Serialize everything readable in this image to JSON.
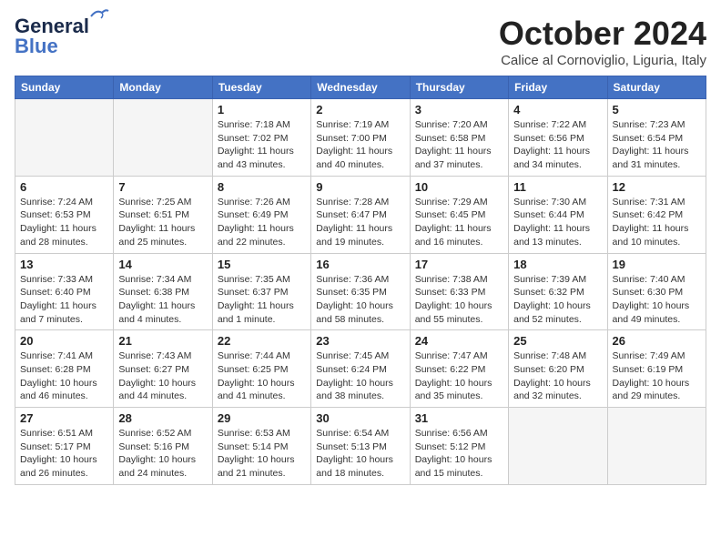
{
  "header": {
    "logo_line1": "General",
    "logo_line2": "Blue",
    "month": "October 2024",
    "location": "Calice al Cornoviglio, Liguria, Italy"
  },
  "weekdays": [
    "Sunday",
    "Monday",
    "Tuesday",
    "Wednesday",
    "Thursday",
    "Friday",
    "Saturday"
  ],
  "weeks": [
    [
      {
        "day": "",
        "info": ""
      },
      {
        "day": "",
        "info": ""
      },
      {
        "day": "1",
        "info": "Sunrise: 7:18 AM\nSunset: 7:02 PM\nDaylight: 11 hours and 43 minutes."
      },
      {
        "day": "2",
        "info": "Sunrise: 7:19 AM\nSunset: 7:00 PM\nDaylight: 11 hours and 40 minutes."
      },
      {
        "day": "3",
        "info": "Sunrise: 7:20 AM\nSunset: 6:58 PM\nDaylight: 11 hours and 37 minutes."
      },
      {
        "day": "4",
        "info": "Sunrise: 7:22 AM\nSunset: 6:56 PM\nDaylight: 11 hours and 34 minutes."
      },
      {
        "day": "5",
        "info": "Sunrise: 7:23 AM\nSunset: 6:54 PM\nDaylight: 11 hours and 31 minutes."
      }
    ],
    [
      {
        "day": "6",
        "info": "Sunrise: 7:24 AM\nSunset: 6:53 PM\nDaylight: 11 hours and 28 minutes."
      },
      {
        "day": "7",
        "info": "Sunrise: 7:25 AM\nSunset: 6:51 PM\nDaylight: 11 hours and 25 minutes."
      },
      {
        "day": "8",
        "info": "Sunrise: 7:26 AM\nSunset: 6:49 PM\nDaylight: 11 hours and 22 minutes."
      },
      {
        "day": "9",
        "info": "Sunrise: 7:28 AM\nSunset: 6:47 PM\nDaylight: 11 hours and 19 minutes."
      },
      {
        "day": "10",
        "info": "Sunrise: 7:29 AM\nSunset: 6:45 PM\nDaylight: 11 hours and 16 minutes."
      },
      {
        "day": "11",
        "info": "Sunrise: 7:30 AM\nSunset: 6:44 PM\nDaylight: 11 hours and 13 minutes."
      },
      {
        "day": "12",
        "info": "Sunrise: 7:31 AM\nSunset: 6:42 PM\nDaylight: 11 hours and 10 minutes."
      }
    ],
    [
      {
        "day": "13",
        "info": "Sunrise: 7:33 AM\nSunset: 6:40 PM\nDaylight: 11 hours and 7 minutes."
      },
      {
        "day": "14",
        "info": "Sunrise: 7:34 AM\nSunset: 6:38 PM\nDaylight: 11 hours and 4 minutes."
      },
      {
        "day": "15",
        "info": "Sunrise: 7:35 AM\nSunset: 6:37 PM\nDaylight: 11 hours and 1 minute."
      },
      {
        "day": "16",
        "info": "Sunrise: 7:36 AM\nSunset: 6:35 PM\nDaylight: 10 hours and 58 minutes."
      },
      {
        "day": "17",
        "info": "Sunrise: 7:38 AM\nSunset: 6:33 PM\nDaylight: 10 hours and 55 minutes."
      },
      {
        "day": "18",
        "info": "Sunrise: 7:39 AM\nSunset: 6:32 PM\nDaylight: 10 hours and 52 minutes."
      },
      {
        "day": "19",
        "info": "Sunrise: 7:40 AM\nSunset: 6:30 PM\nDaylight: 10 hours and 49 minutes."
      }
    ],
    [
      {
        "day": "20",
        "info": "Sunrise: 7:41 AM\nSunset: 6:28 PM\nDaylight: 10 hours and 46 minutes."
      },
      {
        "day": "21",
        "info": "Sunrise: 7:43 AM\nSunset: 6:27 PM\nDaylight: 10 hours and 44 minutes."
      },
      {
        "day": "22",
        "info": "Sunrise: 7:44 AM\nSunset: 6:25 PM\nDaylight: 10 hours and 41 minutes."
      },
      {
        "day": "23",
        "info": "Sunrise: 7:45 AM\nSunset: 6:24 PM\nDaylight: 10 hours and 38 minutes."
      },
      {
        "day": "24",
        "info": "Sunrise: 7:47 AM\nSunset: 6:22 PM\nDaylight: 10 hours and 35 minutes."
      },
      {
        "day": "25",
        "info": "Sunrise: 7:48 AM\nSunset: 6:20 PM\nDaylight: 10 hours and 32 minutes."
      },
      {
        "day": "26",
        "info": "Sunrise: 7:49 AM\nSunset: 6:19 PM\nDaylight: 10 hours and 29 minutes."
      }
    ],
    [
      {
        "day": "27",
        "info": "Sunrise: 6:51 AM\nSunset: 5:17 PM\nDaylight: 10 hours and 26 minutes."
      },
      {
        "day": "28",
        "info": "Sunrise: 6:52 AM\nSunset: 5:16 PM\nDaylight: 10 hours and 24 minutes."
      },
      {
        "day": "29",
        "info": "Sunrise: 6:53 AM\nSunset: 5:14 PM\nDaylight: 10 hours and 21 minutes."
      },
      {
        "day": "30",
        "info": "Sunrise: 6:54 AM\nSunset: 5:13 PM\nDaylight: 10 hours and 18 minutes."
      },
      {
        "day": "31",
        "info": "Sunrise: 6:56 AM\nSunset: 5:12 PM\nDaylight: 10 hours and 15 minutes."
      },
      {
        "day": "",
        "info": ""
      },
      {
        "day": "",
        "info": ""
      }
    ]
  ]
}
